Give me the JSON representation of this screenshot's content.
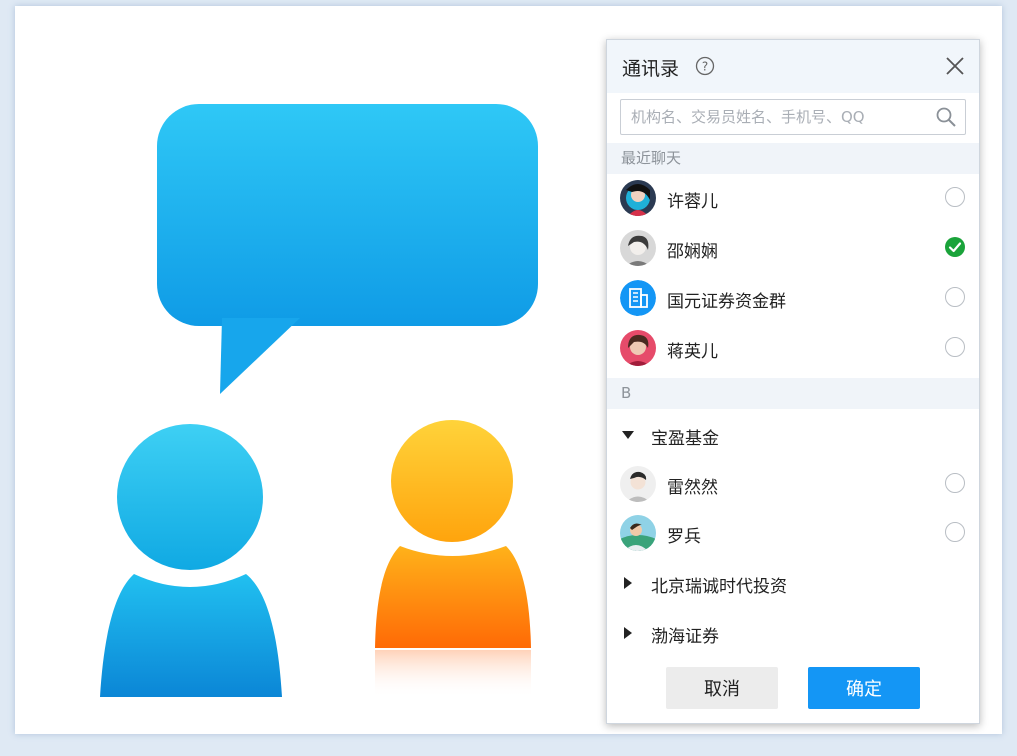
{
  "dialog": {
    "title": "通讯录",
    "search": {
      "placeholder": "机构名、交易员姓名、手机号、QQ"
    },
    "recent_header": "最近聊天",
    "recent": [
      {
        "name": "许蓉儿",
        "avatar": "avatar-photo",
        "selected": false
      },
      {
        "name": "邵娴娴",
        "avatar": "avatar-photo",
        "selected": true
      },
      {
        "name": "国元证券资金群",
        "avatar": "group-building-icon",
        "selected": false
      },
      {
        "name": "蒋英儿",
        "avatar": "avatar-photo",
        "selected": false
      }
    ],
    "letter_header": "B",
    "groups": [
      {
        "name": "宝盈基金",
        "expanded": true,
        "members": [
          {
            "name": "雷然然",
            "selected": false
          },
          {
            "name": "罗兵",
            "selected": false
          }
        ]
      },
      {
        "name": "北京瑞诚时代投资",
        "expanded": false
      },
      {
        "name": "渤海证券",
        "expanded": false
      }
    ],
    "cancel_label": "取消",
    "confirm_label": "确定"
  },
  "colors": {
    "accent": "#1496f5",
    "check": "#1aa33a",
    "bubble": "#18aef0",
    "person_blue": "#14aee8",
    "person_orange": "#ffa20e"
  }
}
